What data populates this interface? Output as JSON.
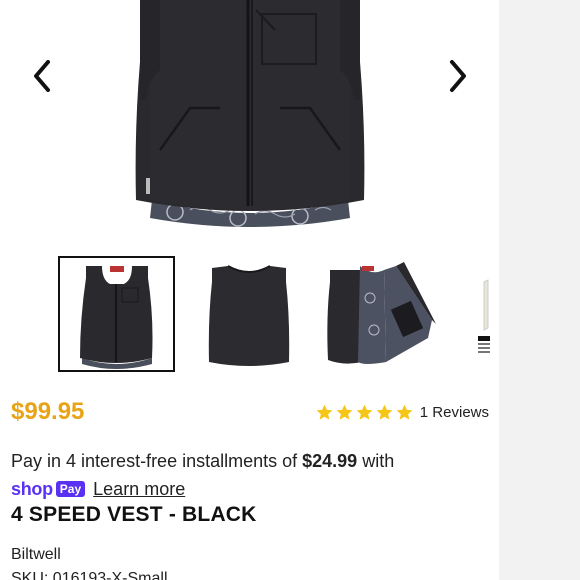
{
  "gallery": {
    "prev_icon": "chevron-left-icon",
    "next_icon": "chevron-right-icon",
    "thumbnails": [
      {
        "name": "vest-front",
        "active": true
      },
      {
        "name": "vest-back",
        "active": false
      },
      {
        "name": "vest-open-lining",
        "active": false
      },
      {
        "name": "vest-detail",
        "active": false
      }
    ]
  },
  "product": {
    "price": "$99.95",
    "rating_stars": 5,
    "reviews_label": "1 Reviews",
    "title": "4 SPEED VEST - BLACK",
    "vendor": "Biltwell",
    "sku": "SKU: 016193-X-Small"
  },
  "installments": {
    "prefix": "Pay in 4 interest-free installments of ",
    "amount": "$24.99",
    "suffix": " with"
  },
  "shoppay": {
    "shop": "shop",
    "pay": "Pay",
    "learn_more": "Learn more"
  },
  "colors": {
    "price": "#e8a317",
    "stars": "#f5c518",
    "shoppay": "#5a31f4"
  }
}
